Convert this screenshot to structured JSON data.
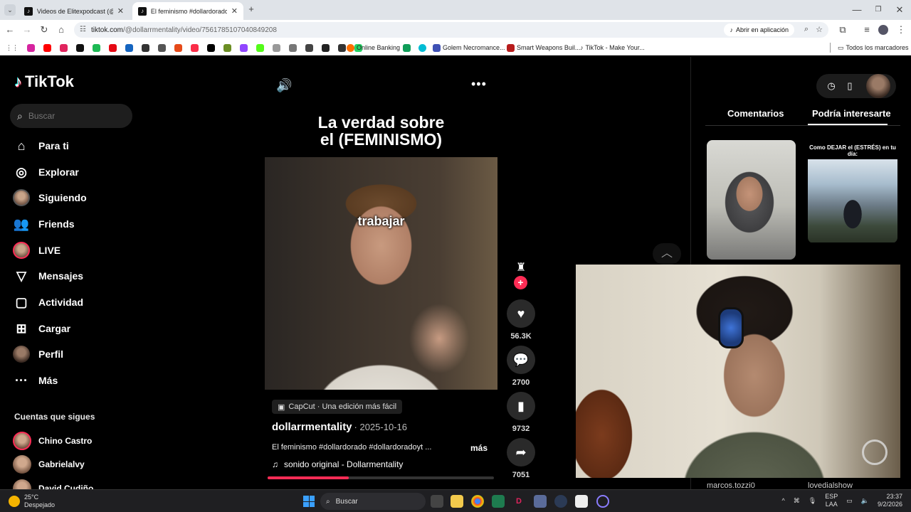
{
  "browser": {
    "tabs": [
      {
        "title": "Videos de Elitexpodcast (@elite",
        "active": false
      },
      {
        "title": "El feminismo #dollardorado #d",
        "active": true
      }
    ],
    "new_tab": "+",
    "url_host": "tiktok.com",
    "url_path": "/@dollarrmentality/video/7561785107040849208",
    "open_app_label": "Abrir en aplicación",
    "bookmarks": [
      "Online Banking",
      "Golem Necromance...",
      "Smart Weapons Buil...",
      "TikTok - Make Your..."
    ],
    "all_bookmarks_label": "Todos los marcadores"
  },
  "sidebar": {
    "logo": "TikTok",
    "search_placeholder": "Buscar",
    "nav": [
      {
        "label": "Para ti",
        "icon": "home-icon"
      },
      {
        "label": "Explorar",
        "icon": "compass-icon"
      },
      {
        "label": "Siguiendo",
        "icon": "following-avatar"
      },
      {
        "label": "Friends",
        "icon": "friends-icon"
      },
      {
        "label": "LIVE",
        "icon": "live-avatar"
      },
      {
        "label": "Mensajes",
        "icon": "send-icon"
      },
      {
        "label": "Actividad",
        "icon": "activity-icon"
      },
      {
        "label": "Cargar",
        "icon": "upload-icon"
      },
      {
        "label": "Perfil",
        "icon": "profile-avatar"
      },
      {
        "label": "Más",
        "icon": "more-icon"
      }
    ],
    "following_title": "Cuentas que sigues",
    "following": [
      "Chino Castro",
      "Gabrielalvy",
      "David Cudiño"
    ]
  },
  "video": {
    "title_line1": "La verdad sobre",
    "title_line2": "el (FEMINISMO)",
    "caption": "trabajar",
    "capcut": "CapCut · Una edición más fácil",
    "author": "dollarrmentality",
    "date": "· 2025-10-16",
    "description": "El feminismo #dollardorado #dollardoradoyt ...",
    "more": "más",
    "sound": "sonido original - Dollarmentality",
    "progress": 0.36
  },
  "actions": {
    "likes": "56.3K",
    "comments": "2700",
    "saves": "9732",
    "shares": "7051"
  },
  "right_panel": {
    "tab_comments": "Comentarios",
    "tab_suggested": "Podría interesarte",
    "thumb2_title": "Como DEJAR el (ESTRÉS) en tu día:",
    "names": [
      "marcos.tozzi0",
      "lovedialshow"
    ]
  },
  "taskbar": {
    "temp": "25°C",
    "weather": "Despejado",
    "search": "Buscar",
    "lang1": "ESP",
    "lang2": "LAA",
    "time": "23:37",
    "date": "9/2/2026"
  }
}
